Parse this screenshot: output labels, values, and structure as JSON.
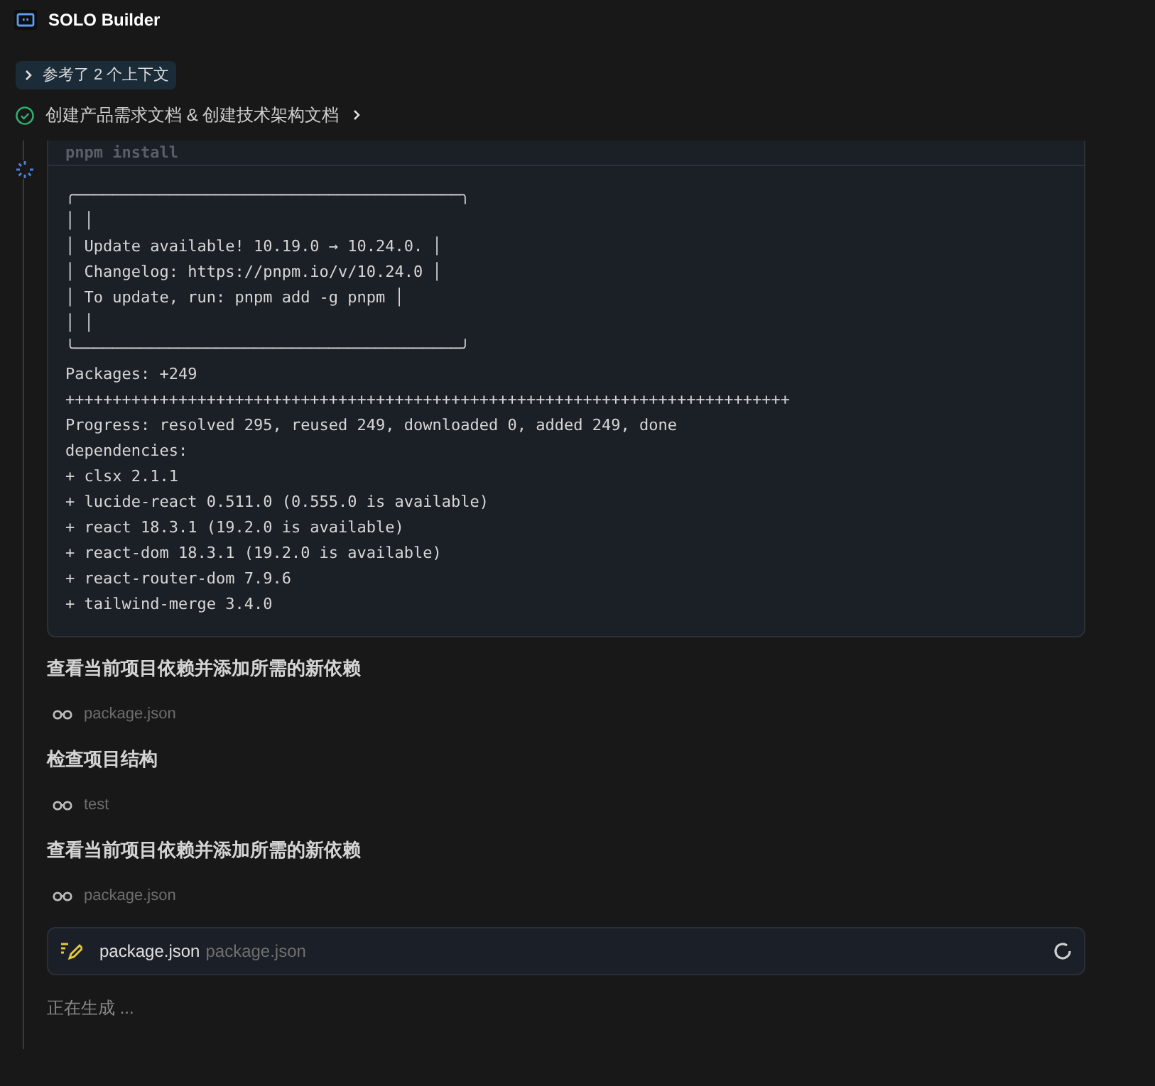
{
  "header": {
    "title": "SOLO Builder"
  },
  "context_toggle": {
    "label": "参考了 2 个上下文",
    "expanded": false
  },
  "task": {
    "label": "创建产品需求文档 & 创建技术架构文档",
    "done": true
  },
  "terminal": {
    "command": "pnpm install",
    "lines": [
      "╭─────────────────────────────────────────╮",
      "│ │",
      "│ Update available! 10.19.0 → 10.24.0. │",
      "│ Changelog: https://pnpm.io/v/10.24.0 │",
      "│ To update, run: pnpm add -g pnpm │",
      "│ │",
      "╰─────────────────────────────────────────╯",
      "Packages: +249",
      "+++++++++++++++++++++++++++++++++++++++++++++++++++++++++++++++++++++++++++++",
      "Progress: resolved 295, reused 249, downloaded 0, added 249, done",
      "dependencies:",
      "+ clsx 2.1.1",
      "+ lucide-react 0.511.0 (0.555.0 is available)",
      "+ react 18.3.1 (19.2.0 is available)",
      "+ react-dom 18.3.1 (19.2.0 is available)",
      "+ react-router-dom 7.9.6",
      "+ tailwind-merge 3.4.0"
    ]
  },
  "steps": [
    {
      "kind": "heading",
      "text": "查看当前项目依赖并添加所需的新依赖"
    },
    {
      "kind": "read",
      "text": "package.json"
    },
    {
      "kind": "heading",
      "text": "检查项目结构"
    },
    {
      "kind": "read",
      "text": "test"
    },
    {
      "kind": "heading",
      "text": "查看当前项目依赖并添加所需的新依赖"
    },
    {
      "kind": "read",
      "text": "package.json"
    },
    {
      "kind": "edit",
      "name": "package.json",
      "path": "package.json",
      "loading": true
    }
  ],
  "status": "正在生成 ..."
}
